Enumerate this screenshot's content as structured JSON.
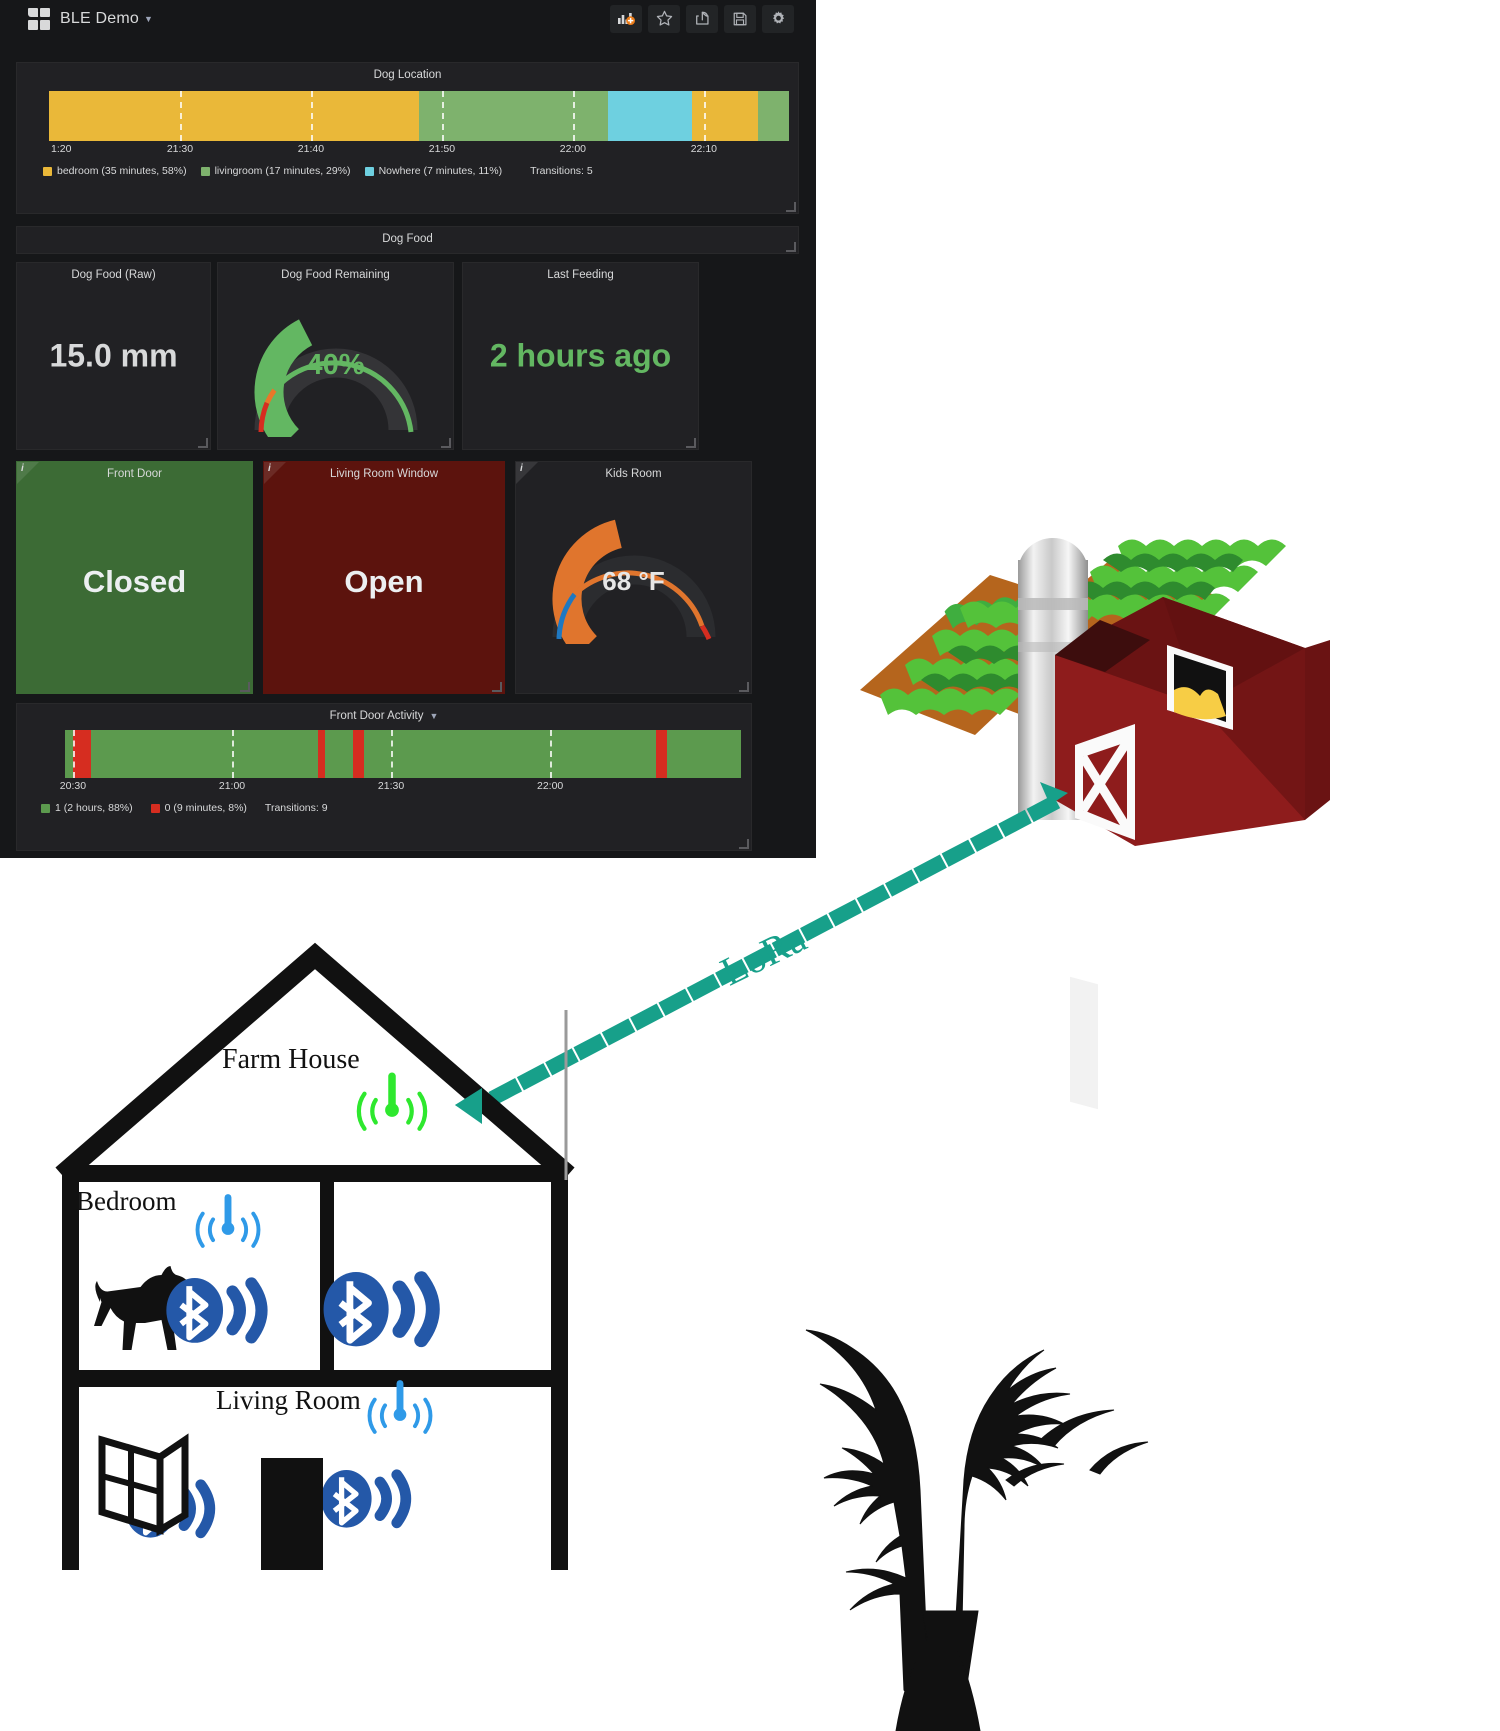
{
  "dashboard": {
    "title": "BLE Demo",
    "logo_icon": "grafana-grid-icon",
    "caret_icon": "chevron-down-icon",
    "toolbar": [
      {
        "name": "add-panel-button",
        "icon": "add-panel-icon",
        "label": "Add panel"
      },
      {
        "name": "star-button",
        "icon": "star-icon",
        "label": "Mark as favorite"
      },
      {
        "name": "share-button",
        "icon": "share-icon",
        "label": "Share dashboard"
      },
      {
        "name": "save-button",
        "icon": "save-icon",
        "label": "Save dashboard"
      },
      {
        "name": "settings-button",
        "icon": "gear-icon",
        "label": "Dashboard settings"
      }
    ]
  },
  "panels": {
    "dog_location": {
      "title": "Dog Location",
      "ticks": [
        "1:20",
        "21:30",
        "21:40",
        "21:50",
        "22:00",
        "22:10"
      ],
      "legend": [
        {
          "label": "bedroom (35 minutes, 58%)",
          "color": "#eab839"
        },
        {
          "label": "livingroom (17 minutes, 29%)",
          "color": "#7eb26d"
        },
        {
          "label": "Nowhere (7 minutes, 11%)",
          "color": "#6ed0e0"
        }
      ],
      "transitions": "Transitions: 5"
    },
    "dog_food_row": {
      "title": "Dog Food"
    },
    "dog_food_raw": {
      "title": "Dog Food (Raw)",
      "value": "15.0 mm"
    },
    "dog_food_remaining": {
      "title": "Dog Food Remaining",
      "value": "40%"
    },
    "last_feeding": {
      "title": "Last Feeding",
      "value": "2 hours ago"
    },
    "front_door": {
      "title": "Front Door",
      "value": "Closed",
      "info_icon": "info-icon"
    },
    "living_room_window": {
      "title": "Living Room Window",
      "value": "Open",
      "info_icon": "info-icon"
    },
    "kids_room": {
      "title": "Kids Room",
      "value": "68 °F",
      "info_icon": "info-icon"
    },
    "front_door_activity": {
      "title": "Front Door Activity",
      "caret_icon": "chevron-down-icon",
      "ticks": [
        "20:30",
        "21:00",
        "21:30",
        "22:00"
      ],
      "legend": [
        {
          "label": "1 (2 hours, 88%)",
          "color": "#5c9a4e"
        },
        {
          "label": "0 (9 minutes, 8%)",
          "color": "#d62d20"
        }
      ],
      "transitions": "Transitions: 9"
    }
  },
  "diagram": {
    "farm_house_label": "Farm House",
    "bedroom_label": "Bedroom",
    "living_room_label": "Living Room",
    "lora_label": "LoRa",
    "icons": {
      "gateway_antenna": "antenna-green-icon",
      "bedroom_antenna": "antenna-blue-icon",
      "living_room_antenna": "antenna-blue-icon",
      "dog_tag": "dog-icon",
      "bluetooth_beacon": "bluetooth-signal-icon",
      "window": "open-window-icon",
      "door": "door-icon",
      "barn": "barn-icon",
      "silo": "silo-icon",
      "field": "crop-field-icon",
      "tree": "bare-tree-icon",
      "lora_link": "lora-dotted-link-icon"
    }
  },
  "chart_data": [
    {
      "type": "bar",
      "title": "Dog Location",
      "orientation": "horizontal-discrete-timeline",
      "xlabel": "",
      "ylabel": "",
      "x_ticks": [
        "1:20",
        "21:30",
        "21:40",
        "21:50",
        "22:00",
        "22:10"
      ],
      "categories": [
        "bedroom",
        "livingroom",
        "Nowhere"
      ],
      "values": [
        58,
        29,
        11
      ],
      "durations_minutes": [
        35,
        17,
        7
      ],
      "colors": [
        "#eab839",
        "#7eb26d",
        "#6ed0e0"
      ],
      "segments": [
        {
          "state": "bedroom",
          "start_pct": 0,
          "width_pct": 50.0,
          "color": "#eab839"
        },
        {
          "state": "livingroom",
          "start_pct": 50.0,
          "width_pct": 25.6,
          "color": "#7eb26d"
        },
        {
          "state": "Nowhere",
          "start_pct": 75.6,
          "width_pct": 11.3,
          "color": "#6ed0e0"
        },
        {
          "state": "bedroom",
          "start_pct": 86.9,
          "width_pct": 8.9,
          "color": "#eab839"
        },
        {
          "state": "livingroom",
          "start_pct": 95.8,
          "width_pct": 4.2,
          "color": "#7eb26d"
        }
      ],
      "transitions": 5,
      "legend_position": "bottom",
      "grid": true
    },
    {
      "type": "gauge",
      "title": "Dog Food Remaining",
      "value": 40,
      "unit": "%",
      "min": 0,
      "max": 100,
      "value_color": "#63b762",
      "thresholds": [
        {
          "from": 0,
          "to": 5,
          "color": "#d62d20"
        },
        {
          "from": 5,
          "to": 12,
          "color": "#e8772a"
        },
        {
          "from": 12,
          "to": 100,
          "color": "#63b762"
        }
      ]
    },
    {
      "type": "gauge",
      "title": "Kids Room",
      "value": 68,
      "unit": "°F",
      "min": 50,
      "max": 90,
      "value_color": "#e0752d",
      "thresholds": [
        {
          "from": 50,
          "to": 58,
          "color": "#1f78c1"
        },
        {
          "from": 58,
          "to": 84,
          "color": "#e0752d"
        },
        {
          "from": 84,
          "to": 90,
          "color": "#d62d20"
        }
      ]
    },
    {
      "type": "bar",
      "title": "Front Door Activity",
      "orientation": "horizontal-discrete-timeline",
      "x_ticks": [
        "20:30",
        "21:00",
        "21:30",
        "22:00"
      ],
      "categories": [
        "1",
        "0"
      ],
      "values": [
        88,
        8
      ],
      "durations": [
        "2 hours",
        "9 minutes"
      ],
      "colors": [
        "#5c9a4e",
        "#d62d20"
      ],
      "segments": [
        {
          "state": "0",
          "start_pct": 1.2,
          "width_pct": 2.6,
          "color": "#d62d20"
        },
        {
          "state": "0",
          "start_pct": 37.5,
          "width_pct": 0.9,
          "color": "#d62d20"
        },
        {
          "state": "0",
          "start_pct": 42.6,
          "width_pct": 1.7,
          "color": "#d62d20"
        },
        {
          "state": "0",
          "start_pct": 87.5,
          "width_pct": 1.6,
          "color": "#d62d20"
        }
      ],
      "transitions": 9,
      "legend_position": "bottom",
      "grid": true
    }
  ]
}
